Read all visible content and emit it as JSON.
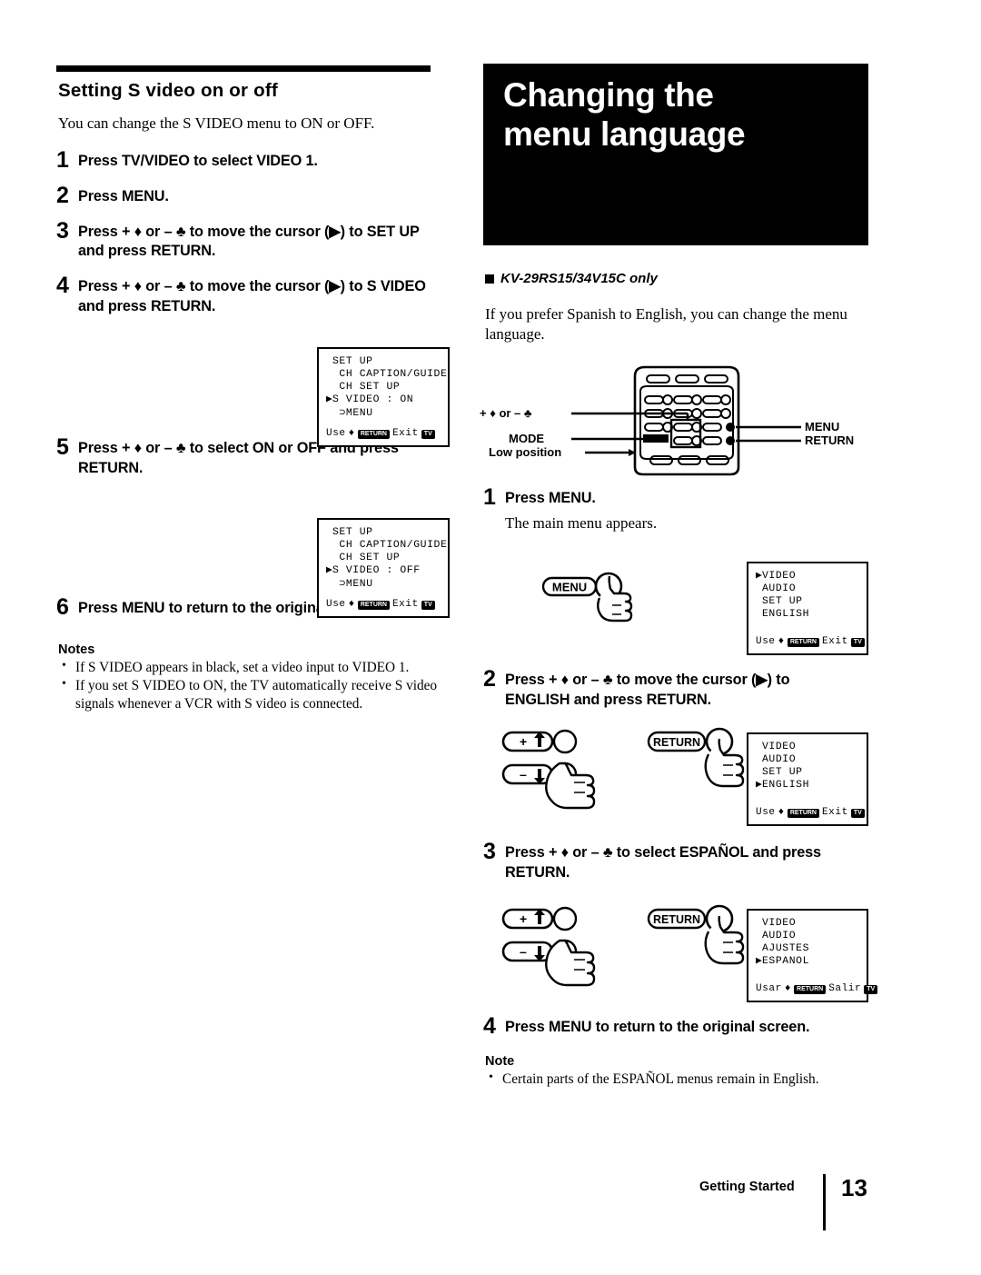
{
  "left": {
    "section_title": "Setting S video on or off",
    "intro": "You can change the S VIDEO menu to ON or OFF.",
    "steps": [
      {
        "num": "1",
        "text": "Press TV/VIDEO to select VIDEO 1."
      },
      {
        "num": "2",
        "text": "Press MENU."
      },
      {
        "num": "3",
        "text": "Press + ♦ or – ♣ to move the cursor (▶) to SET UP and press RETURN."
      },
      {
        "num": "4",
        "text": "Press + ♦ or – ♣ to move the cursor (▶) to S VIDEO and press RETURN."
      },
      {
        "num": "5",
        "text": "Press + ♦ or – ♣ to select ON or OFF and press RETURN."
      },
      {
        "num": "6",
        "text": "Press MENU to return to the original screen."
      }
    ],
    "notes_heading": "Notes",
    "notes": [
      "If S VIDEO  appears in black, set a video input to VIDEO 1.",
      "If you set S VIDEO to ON, the TV automatically receive S video signals whenever a VCR with S video is connected."
    ]
  },
  "right": {
    "banner_line1": "Changing the",
    "banner_line2": "menu language",
    "model_note": "KV-29RS15/34V15C only",
    "intro": "If you prefer Spanish to English, you can change the menu language.",
    "steps": [
      {
        "num": "1",
        "text": "Press MENU.",
        "sub": "The main menu appears."
      },
      {
        "num": "2",
        "text": "Press + ♦ or – ♣ to move the cursor (▶) to ENGLISH and press RETURN."
      },
      {
        "num": "3",
        "text": "Press + ♦ or – ♣ to select ESPAÑOL and press RETURN."
      },
      {
        "num": "4",
        "text": "Press MENU to return to the original screen."
      }
    ],
    "note_heading": "Note",
    "notes": [
      "Certain parts of the ESPAÑOL menus remain in English."
    ]
  },
  "remote": {
    "label_updown": "+ ♦ or – ♣",
    "label_mode": "MODE",
    "label_lowposition": "Low position",
    "label_menu": "MENU",
    "label_return": "RETURN"
  },
  "buttons": {
    "menu": "MENU",
    "return": "RETURN",
    "plus": "+",
    "minus": "–"
  },
  "screens": {
    "setup_on": {
      "lines": [
        "SET UP",
        " CH CAPTION/GUIDE",
        " CH SET UP",
        "S VIDEO : ON",
        " ⊃MENU"
      ],
      "cursor_index": 3,
      "bar_use": "Use",
      "bar_arrow": "♦",
      "bar_key1": "RETURN",
      "bar_exit": "Exit",
      "bar_key2": "TV"
    },
    "setup_off": {
      "lines": [
        "SET UP",
        " CH CAPTION/GUIDE",
        " CH SET UP",
        "S VIDEO : OFF",
        " ⊃MENU"
      ],
      "cursor_index": 3,
      "bar_use": "Use",
      "bar_arrow": "♦",
      "bar_key1": "RETURN",
      "bar_exit": "Exit",
      "bar_key2": "TV"
    },
    "main_menu": {
      "lines": [
        "VIDEO",
        "AUDIO",
        "SET UP",
        "ENGLISH"
      ],
      "cursor_index": 0,
      "bar_use": "Use",
      "bar_arrow": "♦",
      "bar_key1": "RETURN",
      "bar_exit": "Exit",
      "bar_key2": "TV"
    },
    "english_menu": {
      "lines": [
        "VIDEO",
        "AUDIO",
        "SET UP",
        "ENGLISH"
      ],
      "cursor_index": 3,
      "bar_use": "Use",
      "bar_arrow": "♦",
      "bar_key1": "RETURN",
      "bar_exit": "Exit",
      "bar_key2": "TV"
    },
    "espanol_menu": {
      "lines": [
        "VIDEO",
        "AUDIO",
        "AJUSTES",
        "ESPANOL"
      ],
      "cursor_index": 3,
      "bar_use": "Usar",
      "bar_arrow": "♦",
      "bar_key1": "RETURN",
      "bar_exit": "Salir",
      "bar_key2": "TV"
    }
  },
  "footer": {
    "label": "Getting Started",
    "page": "13"
  }
}
